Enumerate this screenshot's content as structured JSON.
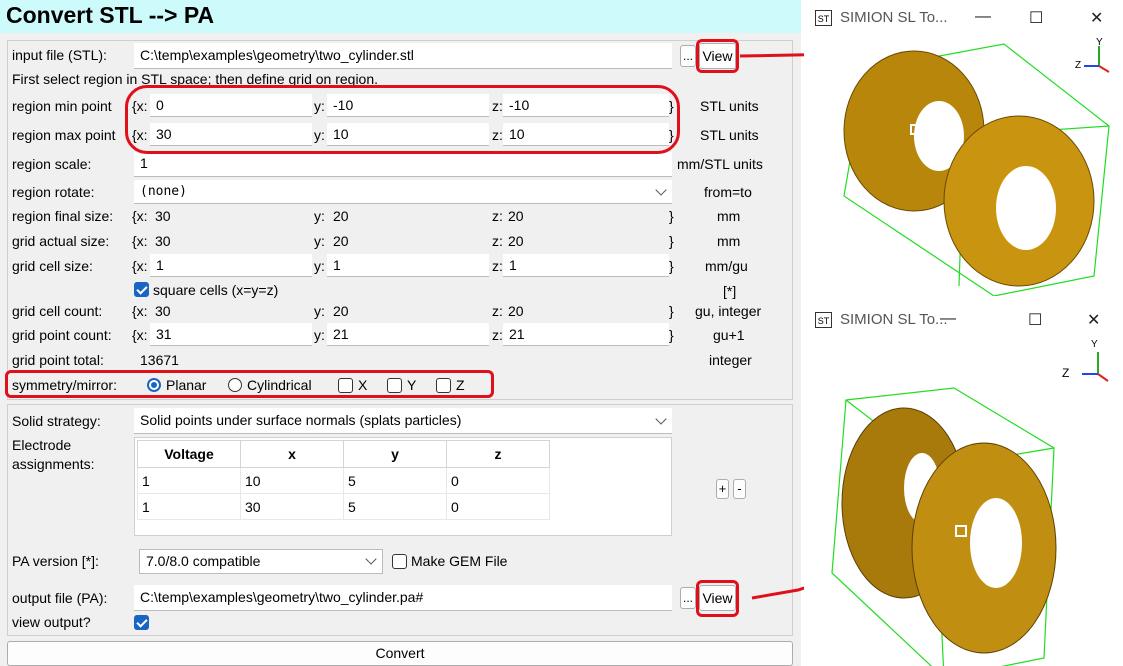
{
  "title": "Convert STL --> PA",
  "input_file": {
    "label": "input file (STL):",
    "value": "C:\\temp\\examples\\geometry\\two_cylinder.stl",
    "browse": "...",
    "view": "View"
  },
  "hint": "First select region in STL space; then define grid on region.",
  "rows": [
    {
      "label": "region min point",
      "x": "0",
      "y": "-10",
      "z": "-10",
      "unit": "STL units"
    },
    {
      "label": "region max point",
      "x": "30",
      "y": "10",
      "z": "10",
      "unit": "STL units"
    }
  ],
  "region_scale": {
    "label": "region scale:",
    "value": "1",
    "unit": "mm/STL units"
  },
  "region_rotate": {
    "label": "region rotate:",
    "value": "(none)",
    "unit": "from=to"
  },
  "region_final": {
    "label": "region final size:",
    "x": "30",
    "y": "20",
    "z": "20",
    "unit": "mm"
  },
  "grid_actual": {
    "label": "grid actual size:",
    "x": "30",
    "y": "20",
    "z": "20",
    "unit": "mm"
  },
  "grid_cell": {
    "label": "grid cell size:",
    "x": "1",
    "y": "1",
    "z": "1",
    "unit": "mm/gu"
  },
  "square_cells": {
    "label": "square cells (x=y=z)",
    "unit": "[*]"
  },
  "grid_count": {
    "label": "grid cell count:",
    "x": "30",
    "y": "20",
    "z": "20",
    "unit": "gu, integer"
  },
  "grid_point_count": {
    "label": "grid point count:",
    "x": "31",
    "y": "21",
    "z": "21",
    "unit": "gu+1"
  },
  "grid_point_total": {
    "label": "grid point total:",
    "value": "13671",
    "unit": "integer"
  },
  "coord": {
    "x": "{x:",
    "y": "y:",
    "z": "z:",
    "close": "}"
  },
  "symmetry": {
    "label": "symmetry/mirror:",
    "planar": "Planar",
    "cylindrical": "Cylindrical",
    "mx": "X",
    "my": "Y",
    "mz": "Z"
  },
  "solid": {
    "label": "Solid strategy:",
    "value": "Solid points under surface normals (splats particles)"
  },
  "electrode": {
    "label1": "Electrode",
    "label2": "assignments:",
    "plus": "+",
    "minus": "-",
    "headers": [
      "Voltage",
      "x",
      "y",
      "z"
    ],
    "rows": [
      [
        "1",
        "10",
        "5",
        "0"
      ],
      [
        "1",
        "30",
        "5",
        "0"
      ]
    ]
  },
  "pa_version": {
    "label": "PA version [*]:",
    "value": "7.0/8.0 compatible",
    "gem": "Make GEM File"
  },
  "output_file": {
    "label": "output file (PA):",
    "value": "C:\\temp\\examples\\geometry\\two_cylinder.pa#",
    "browse": "...",
    "view": "View"
  },
  "view_output": {
    "label": "view output?"
  },
  "convert": "Convert",
  "viewer1": {
    "title": "SIMION SL To...",
    "minimize": "—",
    "maximize": "☐",
    "close": "✕",
    "axis_y": "Y",
    "axis_z": "Z"
  },
  "viewer2": {
    "title": "SIMION SL To...",
    "minimize": "—",
    "maximize": "☐",
    "close": "✕",
    "axis_y": "Y",
    "axis_z": "Z"
  },
  "colors": {
    "accent": "#1a65c4",
    "annotation": "#e0101a",
    "title_bg": "#cdfafa",
    "gold": "#b8860b",
    "box": "#22dd22"
  }
}
